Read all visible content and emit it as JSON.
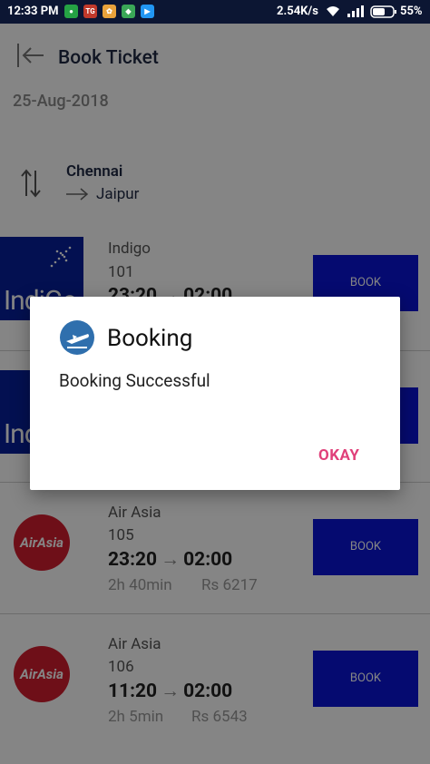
{
  "status_bar": {
    "time": "12:33 PM",
    "speed": "2.54K/s",
    "battery": "55%"
  },
  "header": {
    "title": "Book Ticket"
  },
  "date": "25-Aug-2018",
  "route": {
    "from": "Chennai",
    "to": "Jaipur"
  },
  "flights": [
    {
      "airline": "Indigo",
      "number": "101",
      "depart": "23:20",
      "arrive": "02:00",
      "duration": "",
      "price": "",
      "book": "BOOK",
      "logo_text": "IndiGo"
    },
    {
      "airline": "",
      "number": "",
      "depart": "",
      "arrive": "",
      "duration": "",
      "price": "",
      "book": "",
      "logo_text": "IndiGo"
    },
    {
      "airline": "Air Asia",
      "number": "105",
      "depart": "23:20",
      "arrive": "02:00",
      "duration": "2h 40min",
      "price": "Rs 6217",
      "book": "BOOK",
      "logo_text": "AirAsia"
    },
    {
      "airline": "Air Asia",
      "number": "106",
      "depart": "11:20",
      "arrive": "02:00",
      "duration": "2h 5min",
      "price": "Rs 6543",
      "book": "BOOK",
      "logo_text": "AirAsia"
    }
  ],
  "dialog": {
    "title": "Booking",
    "message": "Booking Successful",
    "ok_label": "OKAY"
  },
  "colors": {
    "status_bar": "#0c1633",
    "book_button": "#0a14d6",
    "indigo": "#07209c",
    "airasia": "#d41e2e",
    "accent": "#e0407a"
  }
}
